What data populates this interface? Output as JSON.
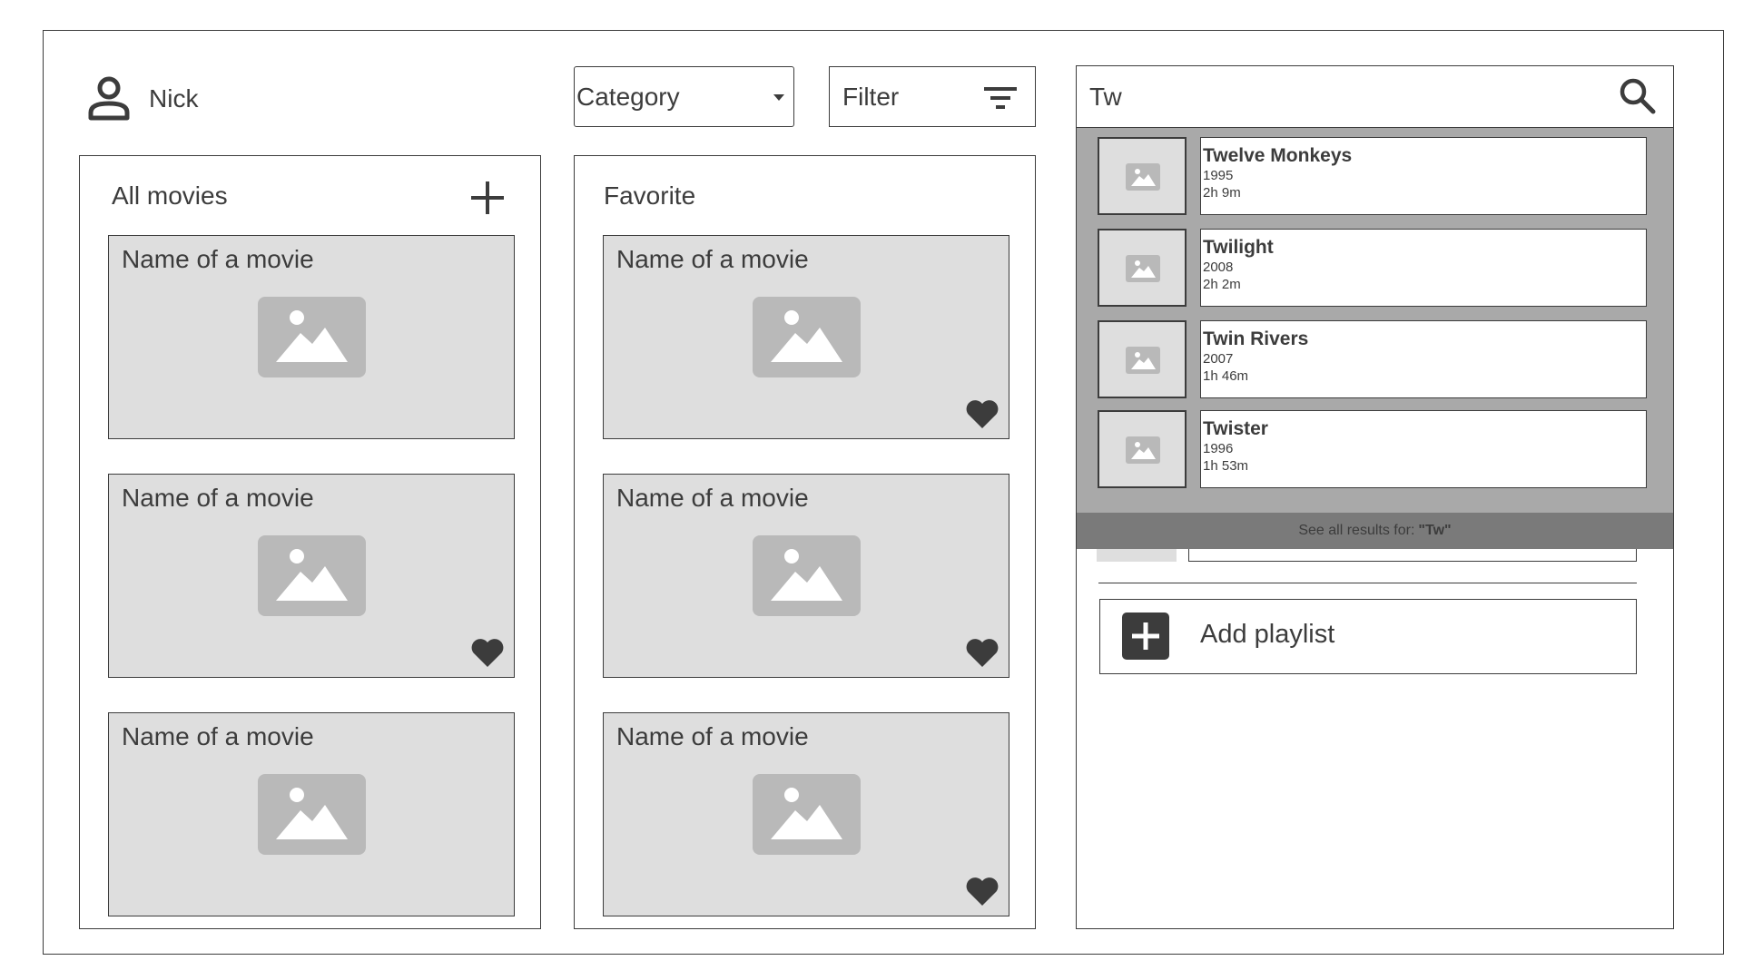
{
  "header": {
    "user_name": "Nick",
    "category_label": "Category",
    "filter_label": "Filter"
  },
  "search": {
    "query": "Tw",
    "results": [
      {
        "title": "Twelve Monkeys",
        "year": "1995",
        "duration": "2h 9m"
      },
      {
        "title": "Twilight",
        "year": "2008",
        "duration": "2h 2m"
      },
      {
        "title": "Twin Rivers",
        "year": "2007",
        "duration": "1h 46m"
      },
      {
        "title": "Twister",
        "year": "1996",
        "duration": "1h 53m"
      }
    ],
    "see_all_prefix": "See all results for:",
    "see_all_query": "\"Tw\""
  },
  "all_movies": {
    "title": "All movies",
    "cards": [
      {
        "name": "Name of a movie",
        "favorite": false
      },
      {
        "name": "Name of a movie",
        "favorite": true
      },
      {
        "name": "Name of a movie",
        "favorite": false
      }
    ]
  },
  "favorite": {
    "title": "Favorite",
    "cards": [
      {
        "name": "Name of a movie",
        "favorite": true
      },
      {
        "name": "Name of a movie",
        "favorite": true
      },
      {
        "name": "Name of a movie",
        "favorite": true
      }
    ]
  },
  "playlists": {
    "add_label": "Add playlist"
  },
  "colors": {
    "ink": "#3c3c3c",
    "card_bg": "#dedede",
    "placeholder": "#b9b9b9",
    "dropdown_bg": "#a9a9a9",
    "see_all_bg": "#7a7a7a"
  }
}
